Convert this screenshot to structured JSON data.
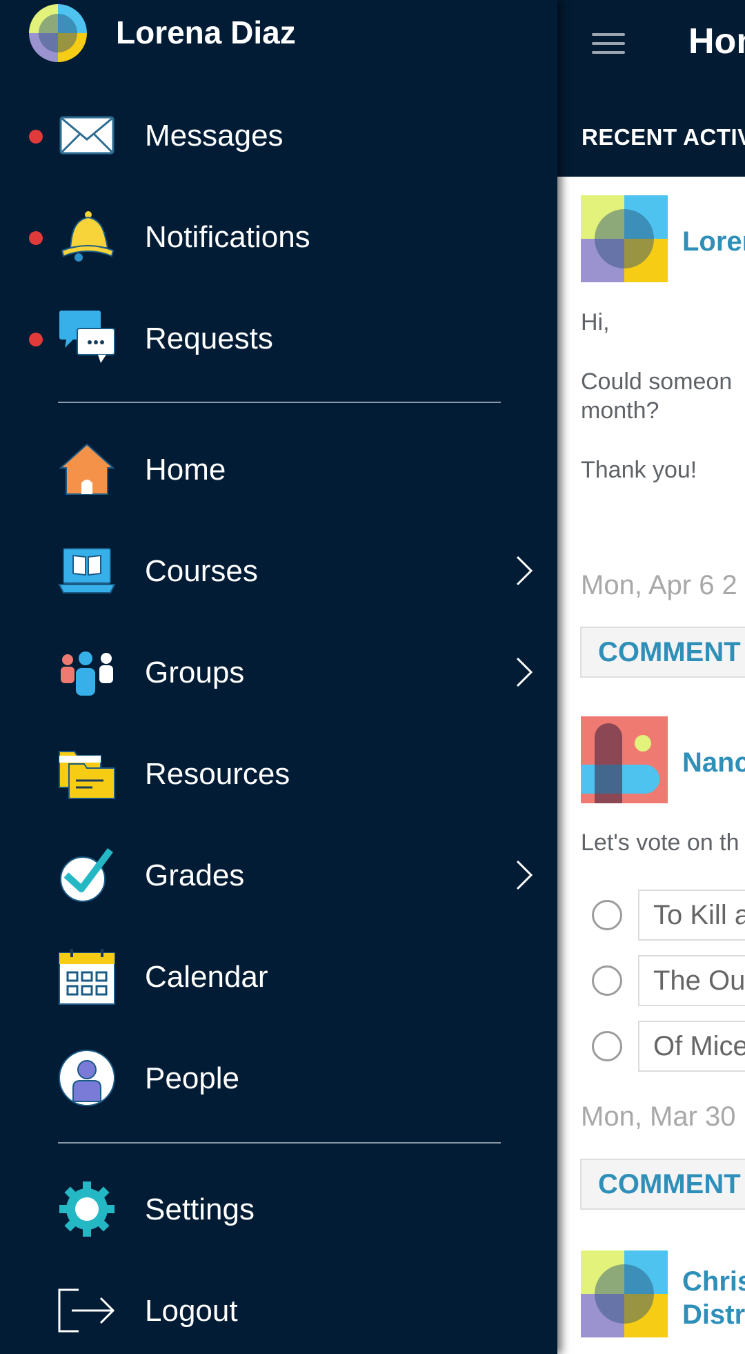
{
  "user": {
    "name": "Lorena Diaz"
  },
  "menu": {
    "primary": [
      {
        "label": "Messages",
        "icon": "envelope-icon",
        "unread": true
      },
      {
        "label": "Notifications",
        "icon": "bell-icon",
        "unread": true
      },
      {
        "label": "Requests",
        "icon": "chat-bubbles-icon",
        "unread": true
      }
    ],
    "main": [
      {
        "label": "Home",
        "icon": "house-icon"
      },
      {
        "label": "Courses",
        "icon": "laptop-book-icon",
        "has_submenu": true
      },
      {
        "label": "Groups",
        "icon": "people-group-icon",
        "has_submenu": true
      },
      {
        "label": "Resources",
        "icon": "folders-icon"
      },
      {
        "label": "Grades",
        "icon": "checkmark-icon",
        "has_submenu": true
      },
      {
        "label": "Calendar",
        "icon": "calendar-icon"
      },
      {
        "label": "People",
        "icon": "person-icon"
      }
    ],
    "footer": [
      {
        "label": "Settings",
        "icon": "gear-icon"
      },
      {
        "label": "Logout",
        "icon": "logout-icon"
      }
    ]
  },
  "background_page": {
    "title": "Hon",
    "section": "RECENT ACTIV",
    "posts": [
      {
        "author": "Loren",
        "lines": [
          "Hi,",
          "Could someon",
          "month?",
          "Thank you!"
        ],
        "date": "Mon, Apr 6 2",
        "comment_label": "COMMENT"
      },
      {
        "author": "Nanc",
        "lines": [
          "Let's vote on th"
        ],
        "poll_options": [
          "To Kill a",
          "The Ou",
          "Of Mice"
        ],
        "date": "Mon, Mar 30",
        "comment_label": "COMMENT"
      },
      {
        "author_lines": [
          "Chris",
          "Distr"
        ]
      }
    ]
  },
  "colors": {
    "drawer_bg": "#021c35",
    "unread_dot": "#e03a3a",
    "link_blue": "#2e8fb8"
  }
}
